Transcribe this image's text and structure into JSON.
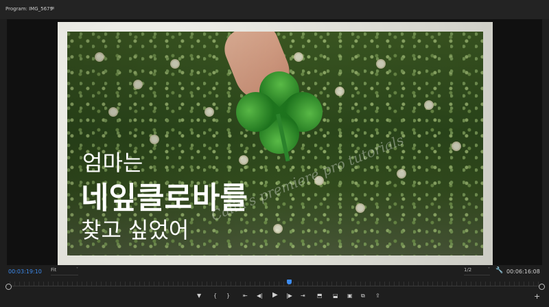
{
  "panel": {
    "title": "Program: IMG_5679",
    "menu_icon": "≡"
  },
  "overlay": {
    "line1": "엄마는",
    "line2": "네잎클로바를",
    "line3": "찾고 싶었어",
    "watermark": "Calin's premiere pro tutorials"
  },
  "footer": {
    "current_timecode": "00:03:19:10",
    "fit_label": "Fit",
    "resolution_label": "1/2",
    "duration_timecode": "00:06:16:08",
    "caret": "˅"
  },
  "controls": {
    "marker": "▼",
    "mark_in": "{",
    "mark_out": "}",
    "go_in": "⇤",
    "step_back": "◀|",
    "play": "▶",
    "step_forward": "|▶",
    "go_out": "⇥",
    "insert": "⬒",
    "overwrite": "⬓",
    "export_frame": "▣",
    "compare": "⧉",
    "export": "⇪",
    "add": "+"
  },
  "colors": {
    "accent": "#3d8cf0",
    "panel_bg": "#1e1e1e"
  }
}
